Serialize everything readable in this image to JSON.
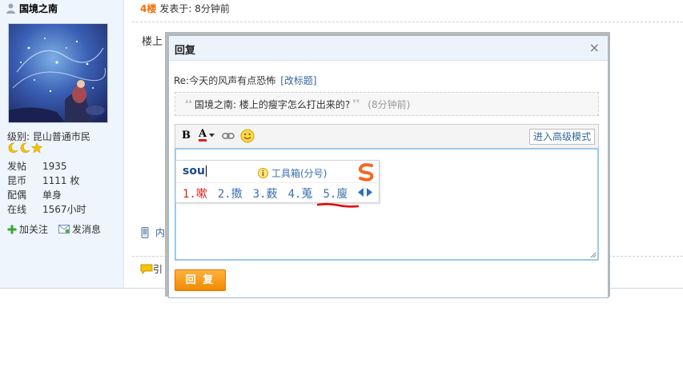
{
  "user": {
    "name": "国境之南",
    "level_label": "级别: 昆山普通市民",
    "stats": [
      {
        "key": "发帖",
        "value": "1935"
      },
      {
        "key": "昆币",
        "value": "1111 枚"
      },
      {
        "key": "配偶",
        "value": "单身"
      },
      {
        "key": "在线",
        "value": "1567小时"
      }
    ],
    "follow_label": "加关注",
    "message_label": "发消息"
  },
  "post": {
    "floor": "4楼",
    "posted_at": "发表于: 8分钟前",
    "body_visible": "楼上",
    "source_visible": "内",
    "quote_visible": "引"
  },
  "popup": {
    "title": "回复",
    "close_label": "×",
    "subject": "Re:今天的风声有点恐怖",
    "edit_subject_label": "[改标题]",
    "quote_open": "❛❛",
    "quote_text": "国境之南: 楼上的瘦字怎么打出来的?",
    "quote_close": "❜❜",
    "quote_time": "(8分钟前)",
    "toolbar": {
      "bold_label": "B",
      "font_color_label": "A",
      "advanced_mode_label": "进入高级模式"
    },
    "submit_label": "回 复"
  },
  "ime": {
    "pinyin": "sou",
    "toolbox_label": "工具箱(分号)",
    "candidates": [
      "1.嗽",
      "2.擞",
      "3.薮",
      "4.蒐",
      "5.廋"
    ]
  },
  "colors": {
    "accent_orange": "#f26c00",
    "link_blue": "#336699",
    "editor_border": "#9bc8ec",
    "sidebar_bg": "#eef5fd"
  }
}
